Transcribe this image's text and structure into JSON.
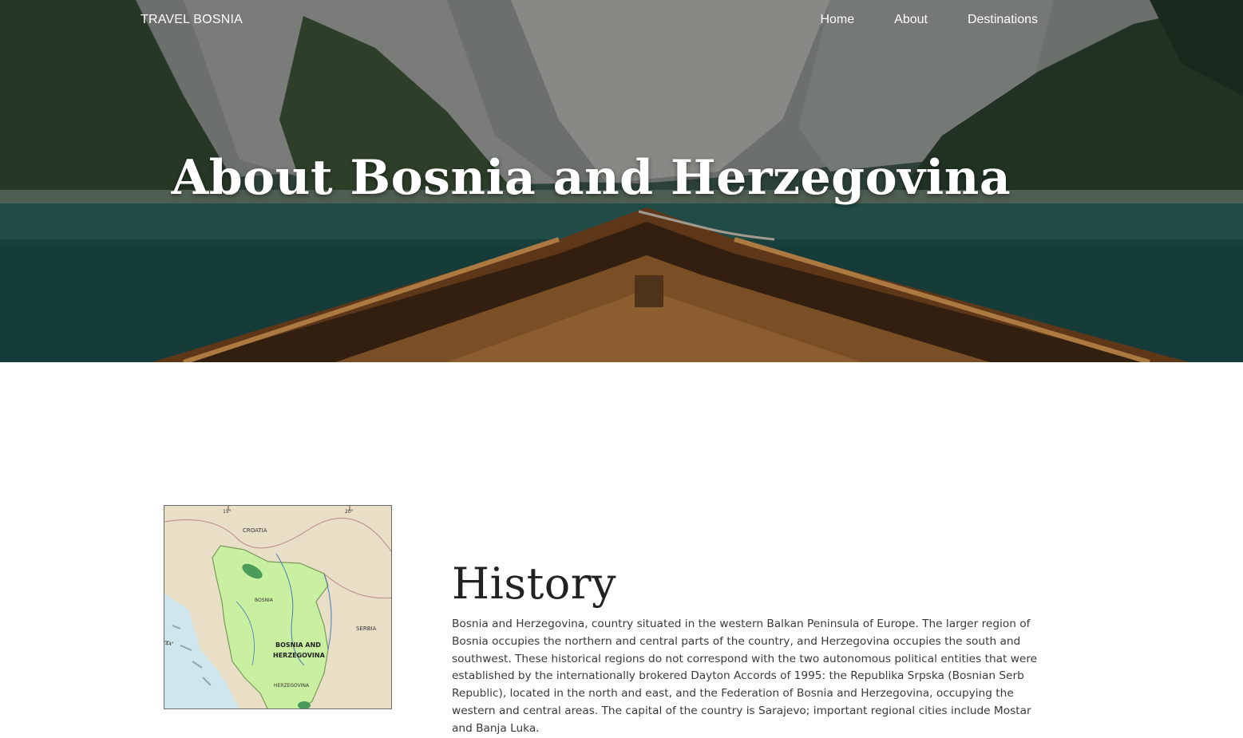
{
  "nav": {
    "brand": "TRAVEL BOSNIA",
    "links": [
      {
        "label": "Home"
      },
      {
        "label": "About"
      },
      {
        "label": "Destinations"
      }
    ]
  },
  "hero": {
    "title": "About Bosnia and Herzegovina"
  },
  "map": {
    "labels": {
      "croatia": "CROATIA",
      "serbia": "SERBIA",
      "country_line1": "BOSNIA AND",
      "country_line2": "HERZEGOVINA",
      "bosnia": "BOSNIA",
      "herzegovina": "HERZEGOVINA",
      "lat_44": "44°",
      "lon_15": "15°",
      "lon_20": "20°"
    }
  },
  "history": {
    "heading": "History",
    "body": "Bosnia and Herzegovina, country situated in the western Balkan Peninsula of Europe. The larger region of Bosnia occupies the northern and central parts of the country, and Herzegovina occupies the south and southwest. These historical regions do not correspond with the two autonomous political entities that were established by the internationally brokered Dayton Accords of 1995: the Republika Srpska (Bosnian Serb Republic), located in the north and east, and the Federation of Bosnia and Herzegovina, occupying the western and central areas. The capital of the country is Sarajevo; important regional cities include Mostar and Banja Luka."
  },
  "colors": {
    "hero_water": "#1f4c4a",
    "boat_wood": "#7a4a22",
    "map_land": "#c8f0a0",
    "map_sea": "#cfe6ee"
  }
}
